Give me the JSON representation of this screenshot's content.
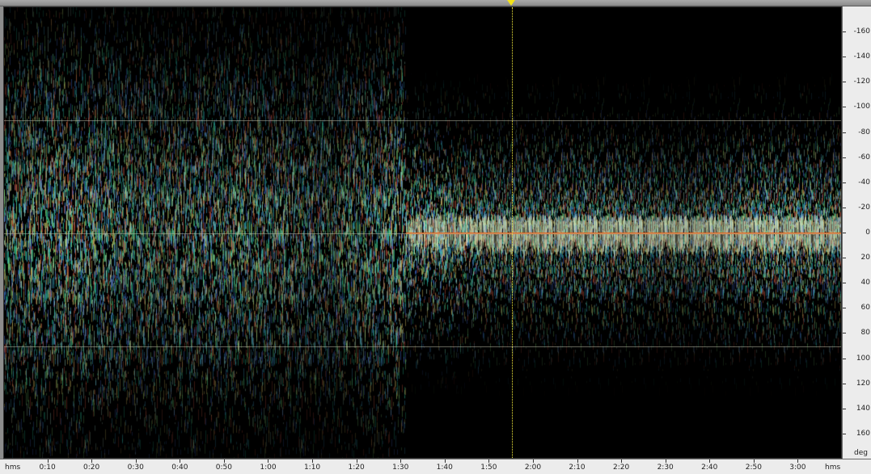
{
  "view": {
    "name": "phase-scope-over-time",
    "cursor_time": "1:55",
    "colors": {
      "background": "#000000",
      "center_line": "#e8651a",
      "playhead": "#f3ea3c",
      "guide_lines": "#b4b4a0",
      "axis_bg": "#ececec",
      "topbar": "#9a9a9a"
    }
  },
  "time_axis": {
    "unit_left": "hms",
    "unit_right": "hms",
    "range_seconds": [
      0,
      190
    ],
    "ticks": [
      {
        "seconds": 10,
        "label": "0:10"
      },
      {
        "seconds": 20,
        "label": "0:20"
      },
      {
        "seconds": 30,
        "label": "0:30"
      },
      {
        "seconds": 40,
        "label": "0:40"
      },
      {
        "seconds": 50,
        "label": "0:50"
      },
      {
        "seconds": 60,
        "label": "1:00"
      },
      {
        "seconds": 70,
        "label": "1:10"
      },
      {
        "seconds": 80,
        "label": "1:20"
      },
      {
        "seconds": 90,
        "label": "1:30"
      },
      {
        "seconds": 100,
        "label": "1:40"
      },
      {
        "seconds": 110,
        "label": "1:50"
      },
      {
        "seconds": 120,
        "label": "2:00"
      },
      {
        "seconds": 130,
        "label": "2:10"
      },
      {
        "seconds": 140,
        "label": "2:20"
      },
      {
        "seconds": 150,
        "label": "2:30"
      },
      {
        "seconds": 160,
        "label": "2:40"
      },
      {
        "seconds": 170,
        "label": "2:50"
      },
      {
        "seconds": 180,
        "label": "3:00"
      }
    ]
  },
  "deg_axis": {
    "unit": "deg",
    "range": [
      -180,
      180
    ],
    "guide_lines": [
      -90,
      0,
      90
    ],
    "ticks": [
      {
        "value": -160,
        "label": "-160"
      },
      {
        "value": -140,
        "label": "-140"
      },
      {
        "value": -120,
        "label": "-120"
      },
      {
        "value": -100,
        "label": "-100"
      },
      {
        "value": -80,
        "label": "-80"
      },
      {
        "value": -60,
        "label": "-60"
      },
      {
        "value": -40,
        "label": "-40"
      },
      {
        "value": -20,
        "label": "-20"
      },
      {
        "value": 0,
        "label": "0"
      },
      {
        "value": 20,
        "label": "20"
      },
      {
        "value": 40,
        "label": "40"
      },
      {
        "value": 60,
        "label": "60"
      },
      {
        "value": 80,
        "label": "80"
      },
      {
        "value": 100,
        "label": "100"
      },
      {
        "value": 120,
        "label": "120"
      },
      {
        "value": 140,
        "label": "140"
      },
      {
        "value": 160,
        "label": "160"
      }
    ]
  },
  "phase_segments": [
    {
      "from_seconds": 0,
      "to_seconds": 91,
      "character": "wide-spread"
    },
    {
      "from_seconds": 91,
      "to_seconds": 190,
      "character": "focused-center"
    }
  ]
}
